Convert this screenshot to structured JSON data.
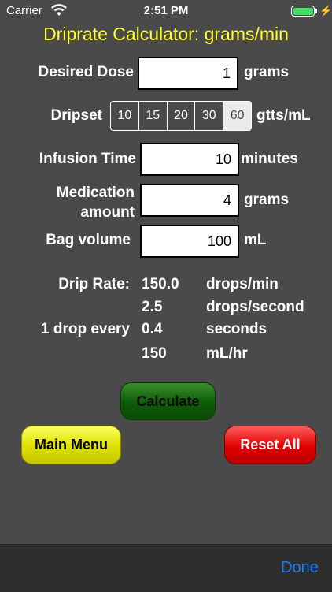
{
  "status": {
    "carrier": "Carrier",
    "time": "2:51 PM",
    "bolt": "⚡"
  },
  "title": "Driprate Calculator: grams/min",
  "dose": {
    "label": "Desired Dose",
    "value": "1",
    "unit": "grams"
  },
  "dripset": {
    "label": "Dripset",
    "options": [
      "10",
      "15",
      "20",
      "30",
      "60"
    ],
    "selected": "60",
    "unit": "gtts/mL"
  },
  "infusion": {
    "label": "Infusion Time",
    "value": "10",
    "unit": "minutes"
  },
  "medication": {
    "label_line1": "Medication",
    "label_line2": "amount",
    "value": "4",
    "unit": "grams"
  },
  "bag": {
    "label": "Bag volume",
    "value": "100",
    "unit": "mL"
  },
  "results": {
    "drip_rate_label": "Drip Rate:",
    "one_drop_label": "1 drop every",
    "rows": [
      {
        "value": "150.0",
        "unit": "drops/min"
      },
      {
        "value": "2.5",
        "unit": "drops/second"
      },
      {
        "value": "0.4",
        "unit": "seconds"
      },
      {
        "value": "150",
        "unit": "mL/hr"
      }
    ]
  },
  "buttons": {
    "calculate": "Calculate",
    "main_menu": "Main Menu",
    "reset_all": "Reset All"
  },
  "toolbar": {
    "done": "Done"
  },
  "colors": {
    "background": "#4a4a4a",
    "title": "#ffff33",
    "calculate": "#0d5b07",
    "main_menu": "#dde000",
    "reset": "#e00000",
    "done": "#1d7bf5"
  }
}
